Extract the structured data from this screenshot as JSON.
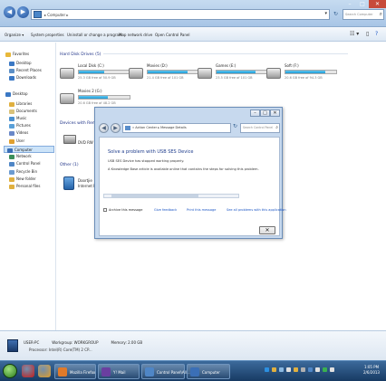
{
  "window": {
    "nav_back_glyph": "◀",
    "nav_forward_glyph": "▶",
    "address_crumb": "▸ Computer ▸",
    "address_dropdown_glyph": "▾",
    "refresh_glyph": "↻",
    "search_placeholder": "Search Computer",
    "search_glyph": "⌕",
    "minimize_glyph": "–",
    "maximize_glyph": "□",
    "close_glyph": "✕"
  },
  "command_bar": {
    "organize": "Organize ▾",
    "system_properties": "System properties",
    "uninstall": "Uninstall or change a program",
    "map_drive": "Map network drive",
    "control_panel": "Open Control Panel",
    "view_glyph": "☷ ▾",
    "pane_glyph": "▯",
    "help_glyph": "?"
  },
  "nav_pane": {
    "items": [
      {
        "label": "Favorites",
        "color": "#e8b83a"
      },
      {
        "label": "Desktop",
        "color": "#3a78c4"
      },
      {
        "label": "Recent Places",
        "color": "#5c8fc6"
      },
      {
        "label": "Downloads",
        "color": "#3a78c4"
      },
      {
        "label": "Desktop",
        "color": "#3a78c4"
      },
      {
        "label": "Libraries",
        "color": "#e0b040"
      },
      {
        "label": "Documents",
        "color": "#d9c27a"
      },
      {
        "label": "Music",
        "color": "#4a90d0"
      },
      {
        "label": "Pictures",
        "color": "#5aa0d8"
      },
      {
        "label": "Videos",
        "color": "#6a88c8"
      },
      {
        "label": "User",
        "color": "#e0a030"
      },
      {
        "label": "Computer",
        "color": "#3b6fb6"
      },
      {
        "label": "Network",
        "color": "#3b8f5a"
      },
      {
        "label": "Control Panel",
        "color": "#4f86c6"
      },
      {
        "label": "Recycle Bin",
        "color": "#6c9bd0"
      },
      {
        "label": "New folder",
        "color": "#e0b040"
      },
      {
        "label": "Personal files",
        "color": "#e0b040"
      }
    ]
  },
  "content": {
    "hdd_header": "Hard Disk Drives (5)",
    "devices_header": "Devices with Removable Storage",
    "other_header": "Other (1)",
    "drives": [
      {
        "name": "Local Disk (C:)",
        "free": "25.3 GB free of 50.9 GB",
        "used_fraction": 0.5
      },
      {
        "name": "Movies (D:)",
        "free": "21.4 GB free of 101 GB",
        "used_fraction": 0.78
      },
      {
        "name": "Games (E:)",
        "free": "23.5 GB free of 101 GB",
        "used_fraction": 0.76
      },
      {
        "name": "Soft (F:)",
        "free": "20.6 GB free of 94.3 GB",
        "used_fraction": 0.78
      },
      {
        "name": "Movies 2 (G:)",
        "free": "20.6 GB free of 48.2 GB",
        "used_fraction": 0.57
      }
    ],
    "device_label": "DVD RW Drive",
    "other_label": "Doortjie Internet Fil"
  },
  "dialog": {
    "minimize_glyph": "–",
    "maximize_glyph": "□",
    "close_glyph": "✕",
    "back_glyph": "◀",
    "forward_glyph": "▶",
    "breadcrumb": "« Action Center ▸ Message Details",
    "refresh_glyph": "↻",
    "search_placeholder": "Search Control Panel",
    "search_glyph": "⌕",
    "title": "Solve a problem with USB SES Device",
    "line1": "USB SES Device has stopped working properly.",
    "line2": "A Knowledge Base article is available online that contains the steps for solving this problem.",
    "archive_label": "Archive this message",
    "give_feedback": "Give feedback",
    "print_label": "Print this message",
    "see_problems": "See all problems with this application",
    "close_button": "✕"
  },
  "details": {
    "computer_name": "USER-PC",
    "workgroup": "Workgroup: WORKGROUP",
    "memory": "Memory: 2.00 GB",
    "processor": "Processor: Intel(R) Core(TM) 2 CP..."
  },
  "taskbar": {
    "buttons": [
      {
        "label": "Mozilla Firefox",
        "color": "#e07a2a"
      },
      {
        "label": "Y! Mail",
        "color": "#6a3fa0"
      },
      {
        "label": "Control Panel\\All...",
        "color": "#4f86c6"
      },
      {
        "label": "Computer",
        "color": "#3b6fb6"
      }
    ],
    "pinned_colors": [
      "#c62020",
      "#e0a030"
    ],
    "tray_colors": [
      "#2c8fe0",
      "#e0b040",
      "#8ab8e0",
      "#e0e0e0",
      "#e0b040",
      "#b0b0b0",
      "#4f86c6",
      "#e0e0e0",
      "#3ab050",
      "#e0e0e0"
    ],
    "time": "1:05 PM",
    "date": "2/6/2013"
  }
}
